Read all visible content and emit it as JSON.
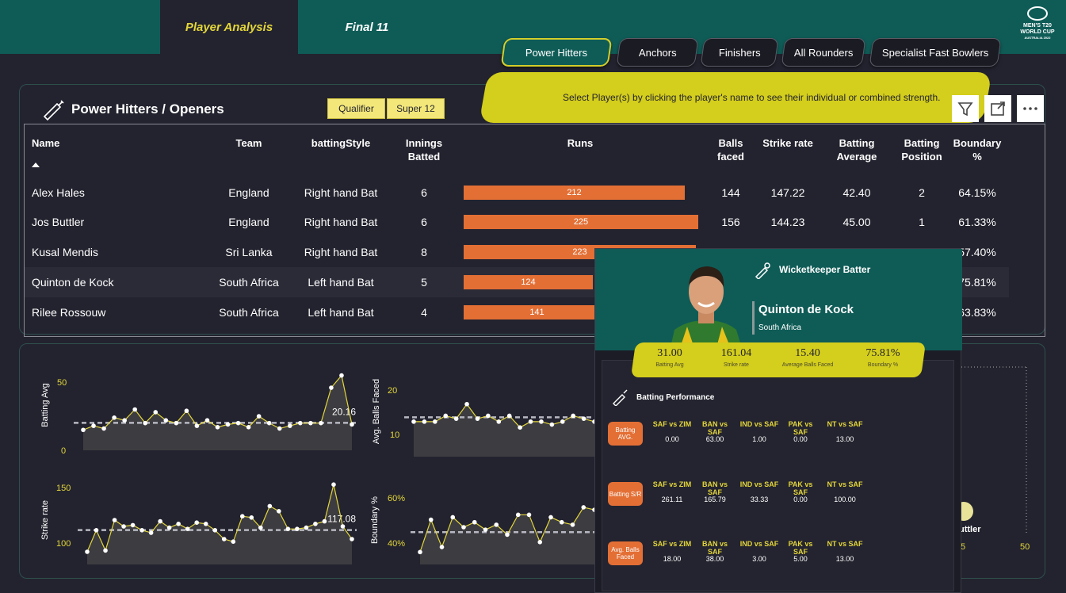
{
  "tabs": [
    {
      "label": "Player Analysis",
      "active": true
    },
    {
      "label": "Final 11",
      "active": false
    }
  ],
  "logo": {
    "line1": "MEN'S T20",
    "line2": "WORLD CUP",
    "line3": "AUSTRALIA 2022"
  },
  "categories": [
    {
      "label": "Power Hitters",
      "active": true
    },
    {
      "label": "Anchors"
    },
    {
      "label": "Finishers"
    },
    {
      "label": "All Rounders"
    },
    {
      "label": "Specialist Fast Bowlers"
    }
  ],
  "instruction": "Select Player(s) by clicking the player's name to see their individual or combined strength.",
  "section": {
    "title": "Power Hitters / Openers"
  },
  "slicers": [
    "Qualifier",
    "Super 12"
  ],
  "table": {
    "headers": {
      "name": "Name",
      "team": "Team",
      "style": "battingStyle",
      "innings": "Innings Batted",
      "runs": "Runs",
      "balls": "Balls faced",
      "sr": "Strike rate",
      "avg": "Batting Average",
      "pos": "Batting Position",
      "boundary": "Boundary %"
    },
    "runs_max": 225,
    "rows": [
      {
        "name": "Alex Hales",
        "team": "England",
        "style": "Right hand Bat",
        "innings": "6",
        "runs": 212,
        "runs_label": "212",
        "balls": "144",
        "sr": "147.22",
        "avg": "42.40",
        "pos": "2",
        "boundary": "64.15%"
      },
      {
        "name": "Jos Buttler",
        "team": "England",
        "style": "Right hand Bat",
        "innings": "6",
        "runs": 225,
        "runs_label": "225",
        "balls": "156",
        "sr": "144.23",
        "avg": "45.00",
        "pos": "1",
        "boundary": "61.33%"
      },
      {
        "name": "Kusal Mendis",
        "team": "Sri Lanka",
        "style": "Right hand Bat",
        "innings": "8",
        "runs": 223,
        "runs_label": "223",
        "balls": "",
        "sr": "",
        "avg": "",
        "pos": "",
        "boundary": "57.40%"
      },
      {
        "name": "Quinton de Kock",
        "team": "South Africa",
        "style": "Left hand Bat",
        "innings": "5",
        "runs": 124,
        "runs_label": "124",
        "balls": "",
        "sr": "",
        "avg": "",
        "pos": "",
        "boundary": "75.81%"
      },
      {
        "name": "Rilee Rossouw",
        "team": "South Africa",
        "style": "Left hand Bat",
        "innings": "4",
        "runs": 141,
        "runs_label": "141",
        "balls": "",
        "sr": "",
        "avg": "",
        "pos": "",
        "boundary": "63.83%"
      }
    ]
  },
  "chart_data": [
    {
      "type": "area",
      "ylabel": "Batting Avg",
      "ylim": [
        0,
        60
      ],
      "yticks": [
        "50",
        "0"
      ],
      "reference_label": "20.16",
      "reference": 20.16,
      "values": [
        15,
        18,
        16,
        24,
        22,
        30,
        20,
        28,
        22,
        20,
        29,
        18,
        22,
        17,
        19,
        20,
        17,
        25,
        20,
        16,
        18,
        20,
        20,
        20,
        46,
        55,
        19
      ]
    },
    {
      "type": "area",
      "ylabel": "Avg. Balls Faced",
      "ylim": [
        0,
        25
      ],
      "yticks": [
        "20",
        "10"
      ],
      "values": [
        12,
        12,
        12,
        14,
        13,
        18,
        13,
        14,
        12,
        14,
        10,
        12,
        12,
        11,
        12,
        14,
        13,
        12
      ]
    },
    {
      "type": "area",
      "ylabel": "Strike rate",
      "ylim": [
        90,
        160
      ],
      "yticks": [
        "150",
        "100"
      ],
      "reference_label": "117.08",
      "reference": 117.08,
      "values": [
        100,
        117,
        101,
        125,
        120,
        121,
        117,
        115,
        124,
        119,
        122,
        118,
        123,
        122,
        117,
        110,
        108,
        128,
        127,
        119,
        136,
        132,
        118,
        118,
        119,
        122,
        124,
        153,
        120,
        110
      ]
    },
    {
      "type": "area",
      "ylabel": "Boundary %",
      "ylim": [
        35,
        65
      ],
      "yticks": [
        "60%",
        "40%"
      ],
      "values": [
        40,
        53,
        42,
        54,
        50,
        52,
        49,
        51,
        47,
        55,
        55,
        44,
        54,
        52,
        51,
        58,
        57
      ]
    },
    {
      "type": "scatter",
      "x_ticks": [
        "5",
        "50"
      ],
      "point_label": "uttler"
    }
  ],
  "tooltip": {
    "role": "Wicketkeeper Batter",
    "name": "Quinton de Kock",
    "team": "South Africa",
    "stats": [
      {
        "value": "31.00",
        "label": "Batting Avg"
      },
      {
        "value": "161.04",
        "label": "Strike rate"
      },
      {
        "value": "15.40",
        "label": "Average Balls Faced"
      },
      {
        "value": "75.81%",
        "label": "Boundary %"
      }
    ],
    "perf_title": "Batting Performance",
    "perf_rows": [
      {
        "badge": "Batting AVG.",
        "headers": [
          "SAF vs ZIM",
          "BAN vs SAF",
          "IND vs SAF",
          "PAK vs SAF",
          "NT vs SAF"
        ],
        "values": [
          "0.00",
          "63.00",
          "1.00",
          "0.00",
          "13.00"
        ]
      },
      {
        "badge": "Batting S/R",
        "headers": [
          "SAF vs ZIM",
          "BAN vs SAF",
          "IND vs SAF",
          "PAK vs SAF",
          "NT vs SAF"
        ],
        "values": [
          "261.11",
          "165.79",
          "33.33",
          "0.00",
          "100.00"
        ]
      },
      {
        "badge": "Avg. Balls Faced",
        "headers": [
          "SAF vs ZIM",
          "BAN vs SAF",
          "IND vs SAF",
          "PAK vs SAF",
          "NT vs SAF"
        ],
        "values": [
          "18.00",
          "38.00",
          "3.00",
          "5.00",
          "13.00"
        ]
      }
    ]
  },
  "colors": {
    "accent": "#d4ce1c",
    "bar": "#e36f35",
    "header": "#0f5c57",
    "background": "#23232f"
  }
}
